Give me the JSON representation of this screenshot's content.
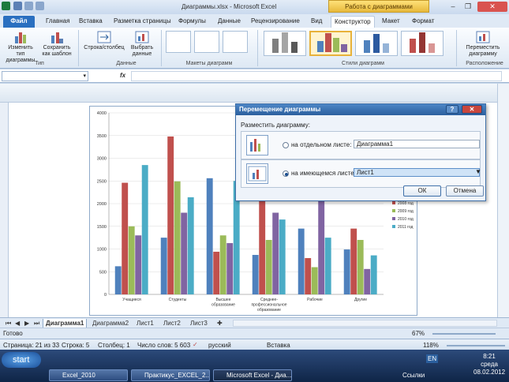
{
  "window": {
    "title": "Диаграммы.xlsx - Microsoft Excel",
    "context_tab": "Работа с диаграммами"
  },
  "tabs": [
    "Файл",
    "Главная",
    "Вставка",
    "Разметка страницы",
    "Формулы",
    "Данные",
    "Рецензирование",
    "Вид",
    "Конструктор",
    "Макет",
    "Формат"
  ],
  "ribbon": {
    "change_type": "Изменить тип диаграммы",
    "save_template": "Сохранить как шаблон",
    "group_type": "Тип",
    "row_col": "Строка/столбец",
    "select_data": "Выбрать данные",
    "group_data": "Данные",
    "group_layouts": "Макеты диаграмм",
    "group_styles": "Стили диаграмм",
    "move_chart": "Переместить диаграмму",
    "group_location": "Расположение"
  },
  "formula_bar": {
    "fx": "fx"
  },
  "chart_data": {
    "type": "bar",
    "categories": [
      "Учащиеся",
      "Студенты",
      "Высшее образование",
      "Среднее-профессиональное образование",
      "Рабочие",
      "Другие"
    ],
    "category_lines": [
      [
        "Учащиеся"
      ],
      [
        "Студенты"
      ],
      [
        "Высшее",
        "образование"
      ],
      [
        "Среднее-",
        "профессиональное",
        "образование"
      ],
      [
        "Рабочие"
      ],
      [
        "Другие"
      ]
    ],
    "yticks": [
      "0",
      "500",
      "1000",
      "1500",
      "2000",
      "2500",
      "3000",
      "3500",
      "4000"
    ],
    "ylim": [
      0,
      4000
    ],
    "series": [
      {
        "name": "2008 год",
        "color": "#4f81bd",
        "values": [
          620,
          1250,
          2560,
          870,
          1450,
          990
        ]
      },
      {
        "name": "2008 год",
        "color": "#c0504d",
        "values": [
          2460,
          3480,
          940,
          2460,
          800,
          1450
        ]
      },
      {
        "name": "2009 год",
        "color": "#9bbb59",
        "values": [
          1500,
          2490,
          1300,
          1200,
          600,
          1200
        ]
      },
      {
        "name": "2010 год",
        "color": "#8064a2",
        "values": [
          1300,
          1800,
          1130,
          1800,
          2480,
          560
        ]
      },
      {
        "name": "2011 год",
        "color": "#4bacc6",
        "values": [
          2850,
          2140,
          2500,
          1650,
          1250,
          860
        ]
      }
    ],
    "legend_visible": [
      "2008 год",
      "2009 год",
      "2010 год",
      "2011 год"
    ],
    "legend_colors": [
      "#c0504d",
      "#9bbb59",
      "#8064a2",
      "#4bacc6"
    ]
  },
  "dialog": {
    "title": "Перемещение диаграммы",
    "help": "?",
    "close": "✕",
    "prompt": "Разместить диаграмму:",
    "option_new": "на отдельном листе:",
    "option_new_value": "Диаграмма1",
    "option_existing": "на имеющемся листе:",
    "option_existing_value": "Лист1",
    "ok": "ОК",
    "cancel": "Отмена"
  },
  "sheet_tabs": [
    "Диаграмма1",
    "Диаграмма2",
    "Лист1",
    "Лист2",
    "Лист3"
  ],
  "status": {
    "ready": "Готово",
    "zoom_small": "67%"
  },
  "status_bar": {
    "page": "Страница: 21 из 33",
    "row": "Строка: 5",
    "col": "Столбец: 1",
    "words": "Число слов: 5 603",
    "lang": "русский",
    "insert": "Вставка",
    "zoom": "118%"
  },
  "taskbar": {
    "start": "start",
    "items": [
      "Excel_2010",
      "Практикус_EXCEL_2...",
      "Microsoft Excel - Диа..."
    ],
    "links": "Ссылки",
    "lang": "EN",
    "time": "8:21",
    "day": "среда",
    "date": "08.02.2012"
  }
}
